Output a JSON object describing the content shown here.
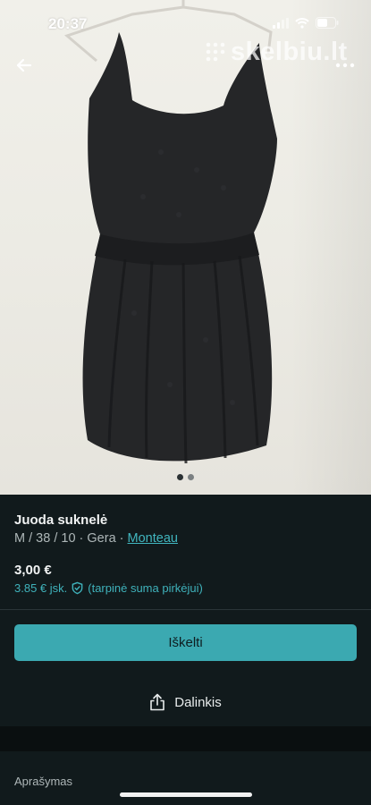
{
  "status_bar": {
    "time": "20:37"
  },
  "gallery": {
    "watermark": "skelbiu.lt",
    "image_count": 2,
    "active_index": 0
  },
  "listing": {
    "title": "Juoda suknelė",
    "size_info": "M / 38 / 10 · Gera · ",
    "brand": "Monteau",
    "price": "3,00 €",
    "price_incl": "3.85 € jsk.",
    "price_incl_note": "(tarpinė suma pirkėjui)"
  },
  "actions": {
    "bump_label": "Iškelti",
    "share_label": "Dalinkis"
  },
  "description": {
    "header": "Aprašymas"
  },
  "colors": {
    "accent": "#3ba9b1",
    "background": "#111a1c",
    "link": "#41b6bf"
  }
}
